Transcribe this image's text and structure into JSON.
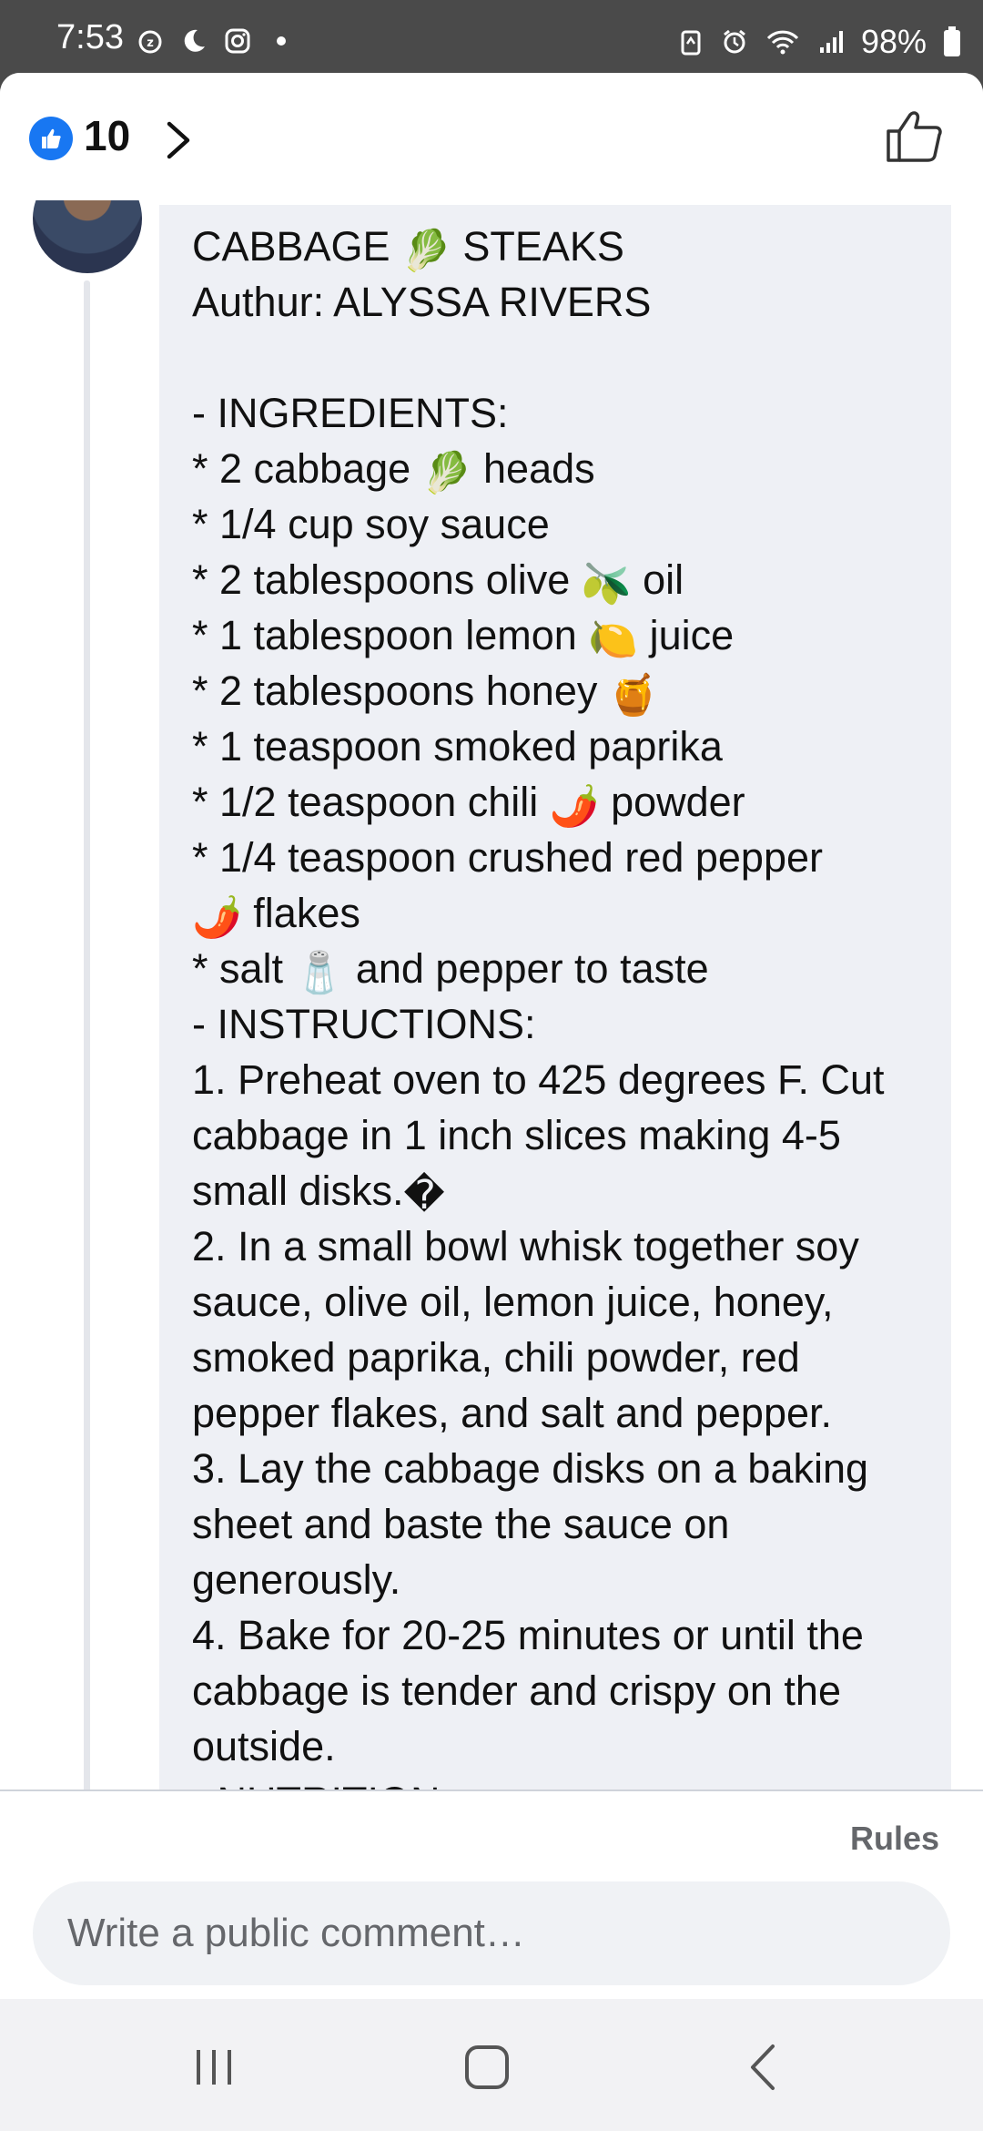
{
  "status_bar": {
    "time": "7:53",
    "battery": "98%",
    "left_icons": [
      "alarm-snooze-icon",
      "moon-icon",
      "instagram-icon",
      "dot-icon"
    ],
    "right_icons": [
      "battery-saver-icon",
      "alarm-icon",
      "wifi-icon",
      "signal-icon",
      "battery-icon"
    ]
  },
  "header": {
    "like_count": "10",
    "accent": "#1877f2"
  },
  "comment": {
    "lines": [
      {
        "t": "CABBAGE ",
        "e": "🥬",
        "a": " STEAKS"
      },
      {
        "t": "Authur: ALYSSA RIVERS"
      },
      {
        "t": ""
      },
      {
        "t": "- INGREDIENTS:"
      },
      {
        "t": "* 2 cabbage ",
        "e": "🥬",
        "a": " heads"
      },
      {
        "t": "* 1/4 cup soy sauce"
      },
      {
        "t": "* 2 tablespoons olive ",
        "e": "🫒",
        "a": "  oil"
      },
      {
        "t": "* 1 tablespoon lemon ",
        "e": "🍋",
        "a": " juice"
      },
      {
        "t": "* 2 tablespoons honey ",
        "e": "🍯",
        "a": ""
      },
      {
        "t": "* 1 teaspoon smoked paprika"
      },
      {
        "t": "* 1/2 teaspoon chili ",
        "e": "🌶️",
        "a": " powder"
      },
      {
        "t": "* 1/4 teaspoon crushed red pepper"
      },
      {
        "t": "",
        "e": "🌶️",
        "a": " flakes"
      },
      {
        "t": "* salt ",
        "e": "🧂",
        "a": "  and pepper to taste"
      },
      {
        "t": "- INSTRUCTIONS:"
      },
      {
        "t": "1. Preheat oven to 425 degrees F. Cut"
      },
      {
        "t": "cabbage in 1 inch slices making 4-5"
      },
      {
        "t": "small disks.",
        "e": "�",
        "a": ""
      },
      {
        "t": "2. In a small bowl whisk together soy"
      },
      {
        "t": "sauce, olive oil, lemon juice, honey,"
      },
      {
        "t": "smoked paprika, chili powder, red"
      },
      {
        "t": "pepper flakes, and salt and pepper."
      },
      {
        "t": "3. Lay the cabbage disks on a baking"
      },
      {
        "t": "sheet and baste the sauce on"
      },
      {
        "t": "generously."
      },
      {
        "t": "4. Bake for 20-25 minutes or until the"
      },
      {
        "t": "cabbage is tender and crispy on the"
      },
      {
        "t": "outside."
      },
      {
        "t": "- NUTRITION:"
      }
    ]
  },
  "footer": {
    "rules_label": "Rules",
    "comment_placeholder": "Write a public comment…"
  },
  "nav": {
    "icons": [
      "recents-icon",
      "home-icon",
      "back-icon"
    ]
  }
}
